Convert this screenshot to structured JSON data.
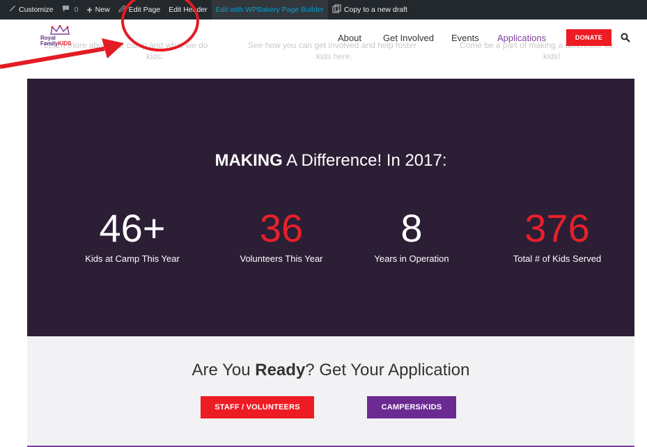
{
  "admin_bar": {
    "customize": "Customize",
    "comments_count": "0",
    "new": "New",
    "edit_page": "Edit Page",
    "edit_header": "Edit Header",
    "wpbakery": "Edit with WPBakery Page Builder",
    "copy_draft": "Copy to a new draft"
  },
  "header": {
    "logo_line1": "Royal",
    "logo_line2a": "Family",
    "logo_line2b": "KIDS",
    "ghost_text_1a": "Learn more about our camp and what we do",
    "ghost_text_1b": "kids.",
    "ghost_text_2a": "See how you can get involved and help foster",
    "ghost_text_2b": "kids here.",
    "ghost_text_3a": "Come be a part of making a difference for",
    "ghost_text_3b": "kids!",
    "nav": [
      "About",
      "Get Involved",
      "Events",
      "Applications"
    ],
    "donate": "DONATE"
  },
  "stats": {
    "title_bold": "MAKING",
    "title_rest": " A Difference! In 2017:",
    "items": [
      {
        "number": "46+",
        "label": "Kids at Camp This Year"
      },
      {
        "number": "36",
        "label": "Volunteers This Year"
      },
      {
        "number": "8",
        "label": "Years in Operation"
      },
      {
        "number": "376",
        "label": "Total # of Kids Served"
      }
    ]
  },
  "apply": {
    "title_pre": "Are You ",
    "title_bold": "Ready",
    "title_post": "? Get Your Application",
    "staff_button": "STAFF / VOLUNTEERS",
    "camper_button": "CAMPERS/KIDS"
  },
  "colors": {
    "accent_red": "#ed1c24",
    "accent_purple": "#6b2a91",
    "stats_bg": "#2c1e35",
    "admin_bar": "#23282d"
  }
}
